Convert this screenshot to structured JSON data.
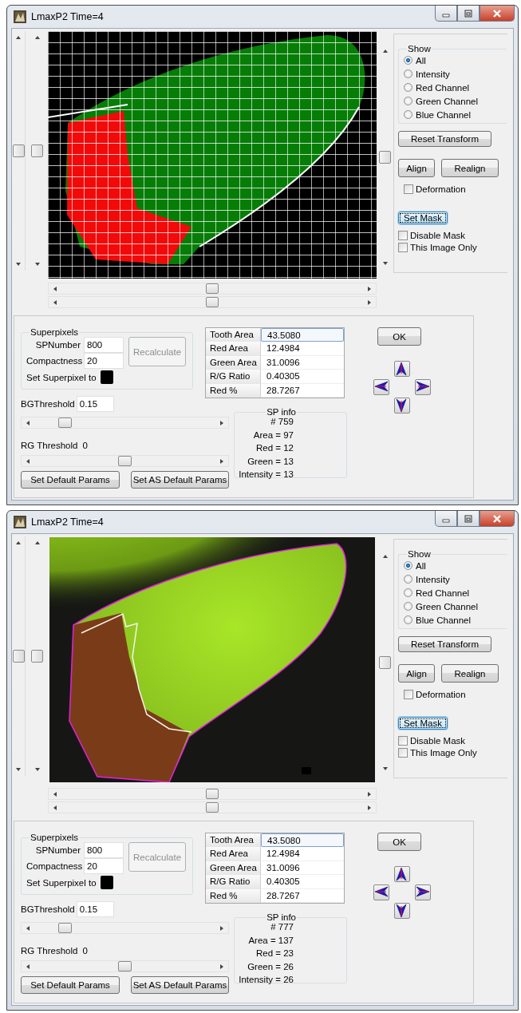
{
  "windows": [
    {
      "title": "LmaxP2 Time=4",
      "image": {
        "kind": "segmentation"
      },
      "show": {
        "label": "Show",
        "options": [
          {
            "label": "All",
            "selected": true
          },
          {
            "label": "Intensity",
            "selected": false
          },
          {
            "label": "Red Channel",
            "selected": false
          },
          {
            "label": "Green Channel",
            "selected": false
          },
          {
            "label": "Blue Channel",
            "selected": false
          }
        ]
      },
      "reset_button": "Reset Transform",
      "align_button": "Align",
      "realign_button": "Realign",
      "deformation": {
        "label": "Deformation",
        "checked": false
      },
      "set_mask_button": {
        "label": "Set Mask",
        "focused": true
      },
      "disable_mask": {
        "label": "Disable Mask",
        "checked": false
      },
      "this_image_only": {
        "label": "This Image Only",
        "checked": false
      },
      "superpixels": {
        "label": "Superpixels",
        "fields": [
          {
            "label": "SPNumber",
            "value": "800"
          },
          {
            "label": "Compactness",
            "value": "20"
          }
        ],
        "recalculate": {
          "label": "Recalculate",
          "disabled": true
        },
        "set_superpixel_label": "Set Superpixel to"
      },
      "bg_threshold": {
        "label": "BGThreshold",
        "value": "0.15",
        "level": 0.21
      },
      "rg_threshold": {
        "label": "RG Threshold",
        "value": "0",
        "level": 0.5
      },
      "default_buttons": [
        "Set Default Params",
        "Set AS Default Params"
      ],
      "results": [
        {
          "name": "Tooth Area",
          "value": "43.5080",
          "selected": true
        },
        {
          "name": "Red Area",
          "value": "12.4984",
          "selected": false
        },
        {
          "name": "Green Area",
          "value": "31.0096",
          "selected": false
        },
        {
          "name": "R/G Ratio",
          "value": "0.40305",
          "selected": false
        },
        {
          "name": "Red %",
          "value": "28.7267",
          "selected": false
        }
      ],
      "sp_info": {
        "title": "SP info",
        "lines": [
          "# 759",
          "Area = 97",
          "Red = 12",
          "Green = 13",
          "Intensity = 13"
        ]
      },
      "ok_button": "OK"
    },
    {
      "title": "LmaxP2 Time=4",
      "show": {
        "label": "Show",
        "options": [
          {
            "label": "All",
            "selected": true
          },
          {
            "label": "Intensity",
            "selected": false
          },
          {
            "label": "Red Channel",
            "selected": false
          },
          {
            "label": "Green Channel",
            "selected": false
          },
          {
            "label": "Blue Channel",
            "selected": false
          }
        ]
      },
      "reset_button": "Reset Transform",
      "align_button": "Align",
      "realign_button": "Realign",
      "deformation": {
        "label": "Deformation",
        "checked": false
      },
      "set_mask_button": {
        "label": "Set Mask",
        "focused": true
      },
      "disable_mask": {
        "label": "Disable Mask",
        "checked": false
      },
      "this_image_only": {
        "label": "This Image Only",
        "checked": false
      },
      "superpixels": {
        "label": "Superpixels",
        "fields": [
          {
            "label": "SPNumber",
            "value": "800"
          },
          {
            "label": "Compactness",
            "value": "20"
          }
        ],
        "recalculate": {
          "label": "Recalculate",
          "disabled": true
        },
        "set_superpixel_label": "Set Superpixel to"
      },
      "bg_threshold": {
        "label": "BGThreshold",
        "value": "0.15",
        "level": 0.21
      },
      "rg_threshold": {
        "label": "RG Threshold",
        "value": "0",
        "level": 0.5
      },
      "default_buttons": [
        "Set Default Params",
        "Set AS Default Params"
      ],
      "results": [
        {
          "name": "Tooth Area",
          "value": "43.5080",
          "selected": true
        },
        {
          "name": "Red Area",
          "value": "12.4984",
          "selected": false
        },
        {
          "name": "Green Area",
          "value": "31.0096",
          "selected": false
        },
        {
          "name": "R/G Ratio",
          "value": "0.40305",
          "selected": false
        },
        {
          "name": "Red %",
          "value": "28.7267",
          "selected": false
        }
      ],
      "sp_info": {
        "title": "SP info",
        "lines": [
          "# 777",
          "Area = 137",
          "Red = 23",
          "Green = 26",
          "Intensity = 26"
        ]
      },
      "ok_button": "OK"
    }
  ]
}
